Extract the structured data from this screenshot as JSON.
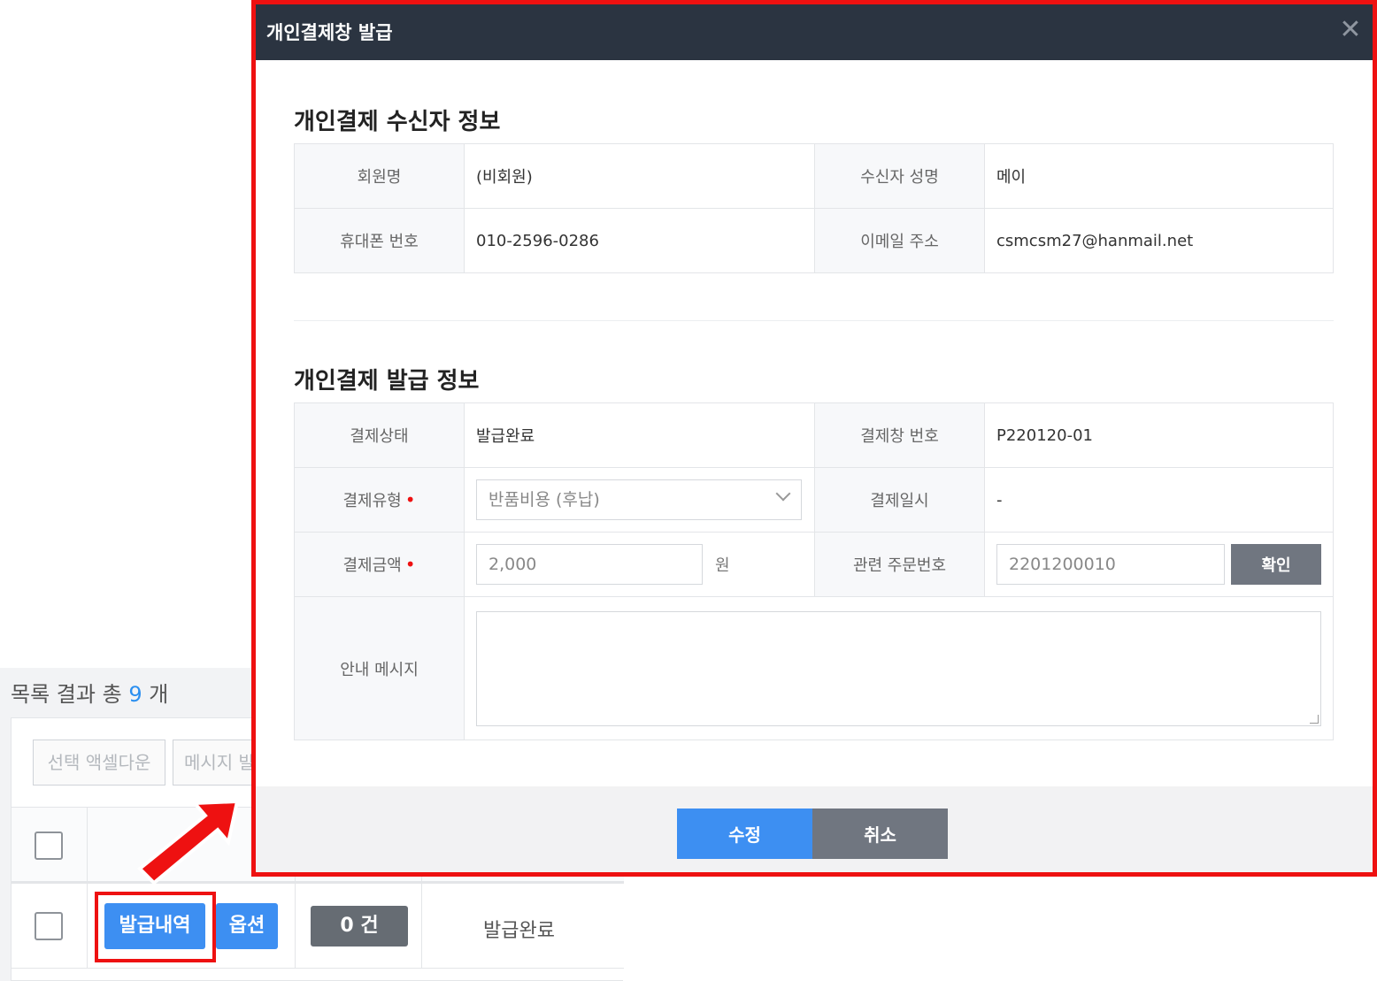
{
  "background": {
    "result_prefix": "목록 결과 총",
    "result_count": "9",
    "result_suffix": "개",
    "excel_button": "선택 액셀다운",
    "message_button": "메시지 발",
    "row": {
      "history_button": "발급내역",
      "option_button": "옵션",
      "count_badge": "0 건",
      "status": "발급완료"
    }
  },
  "modal": {
    "title": "개인결제창 발급",
    "recipient_section": {
      "title": "개인결제 수신자 정보",
      "member_label": "회원명",
      "member_value": "(비회원)",
      "name_label": "수신자 성명",
      "name_value": "메이",
      "phone_label": "휴대폰 번호",
      "phone_value": "010-2596-0286",
      "email_label": "이메일 주소",
      "email_value": "csmcsm27@hanmail.net"
    },
    "issue_section": {
      "title": "개인결제 발급 정보",
      "status_label": "결제상태",
      "status_value": "발급완료",
      "window_no_label": "결제창 번호",
      "window_no_value": "P220120-01",
      "type_label": "결제유형",
      "type_value": "반품비용 (후납)",
      "date_label": "결제일시",
      "date_value": "-",
      "amount_label": "결제금액",
      "amount_value": "2,000",
      "amount_unit": "원",
      "order_label": "관련 주문번호",
      "order_value": "2201200010",
      "confirm_button": "확인",
      "message_label": "안내 메시지",
      "message_value": ""
    },
    "required_mark": "•",
    "save_button": "수정",
    "cancel_button": "취소"
  },
  "colors": {
    "accent_blue": "#3d8ff2",
    "header_dark": "#2b3441",
    "highlight_red": "#ee1111",
    "gray_button": "#707680"
  }
}
